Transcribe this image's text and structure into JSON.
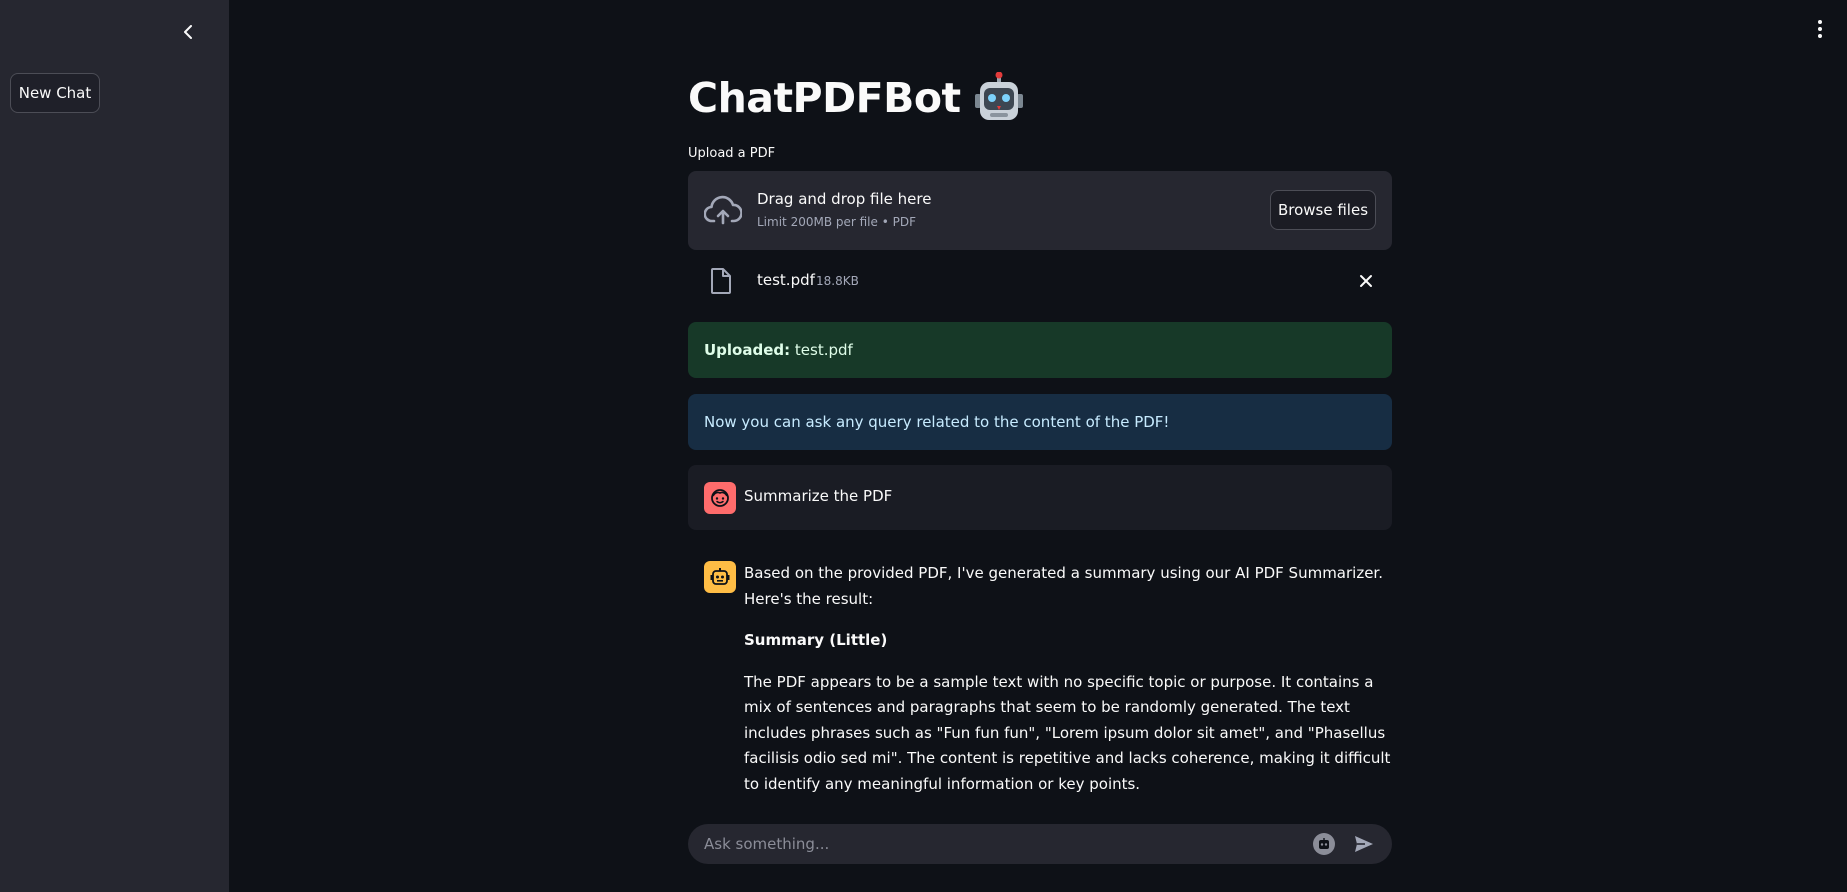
{
  "sidebar": {
    "new_chat_label": "New Chat"
  },
  "main": {
    "title": "ChatPDFBot",
    "title_emoji": "🤖",
    "upload_label": "Upload a PDF",
    "dropzone": {
      "title": "Drag and drop file here",
      "subtitle": "Limit 200MB per file • PDF",
      "browse_label": "Browse files"
    },
    "file": {
      "name": "test.pdf",
      "size": "18.8KB"
    },
    "success_alert": {
      "label": "Uploaded:",
      "value": "test.pdf"
    },
    "info_alert": "Now you can ask any query related to the content of the PDF!",
    "messages": {
      "user": "Summarize the PDF",
      "assistant": {
        "intro": "Based on the provided PDF, I've generated a summary using our AI PDF Summarizer. Here's the result:",
        "heading": "Summary (Little)",
        "body": "The PDF appears to be a sample text with no specific topic or purpose. It contains a mix of sentences and paragraphs that seem to be randomly generated. The text includes phrases such as \"Fun fun fun\", \"Lorem ipsum dolor sit amet\", and \"Phasellus facilisis odio sed mi\". The content is repetitive and lacks coherence, making it difficult to identify any meaningful information or key points."
      }
    },
    "chat_input": {
      "placeholder": "Ask something..."
    }
  },
  "colors": {
    "background": "#0e1117",
    "sidebar": "#262730",
    "success_bg": "#173928",
    "info_bg": "#172d43",
    "user_avatar": "#ff6c6c",
    "bot_avatar": "#ffbd45"
  },
  "icons": {
    "collapse": "chevron-left-icon",
    "menu": "more-vertical-icon",
    "upload": "cloud-upload-icon",
    "file": "file-icon",
    "remove": "close-icon",
    "user_avatar": "face-icon",
    "bot_avatar": "robot-icon",
    "send": "send-icon"
  }
}
